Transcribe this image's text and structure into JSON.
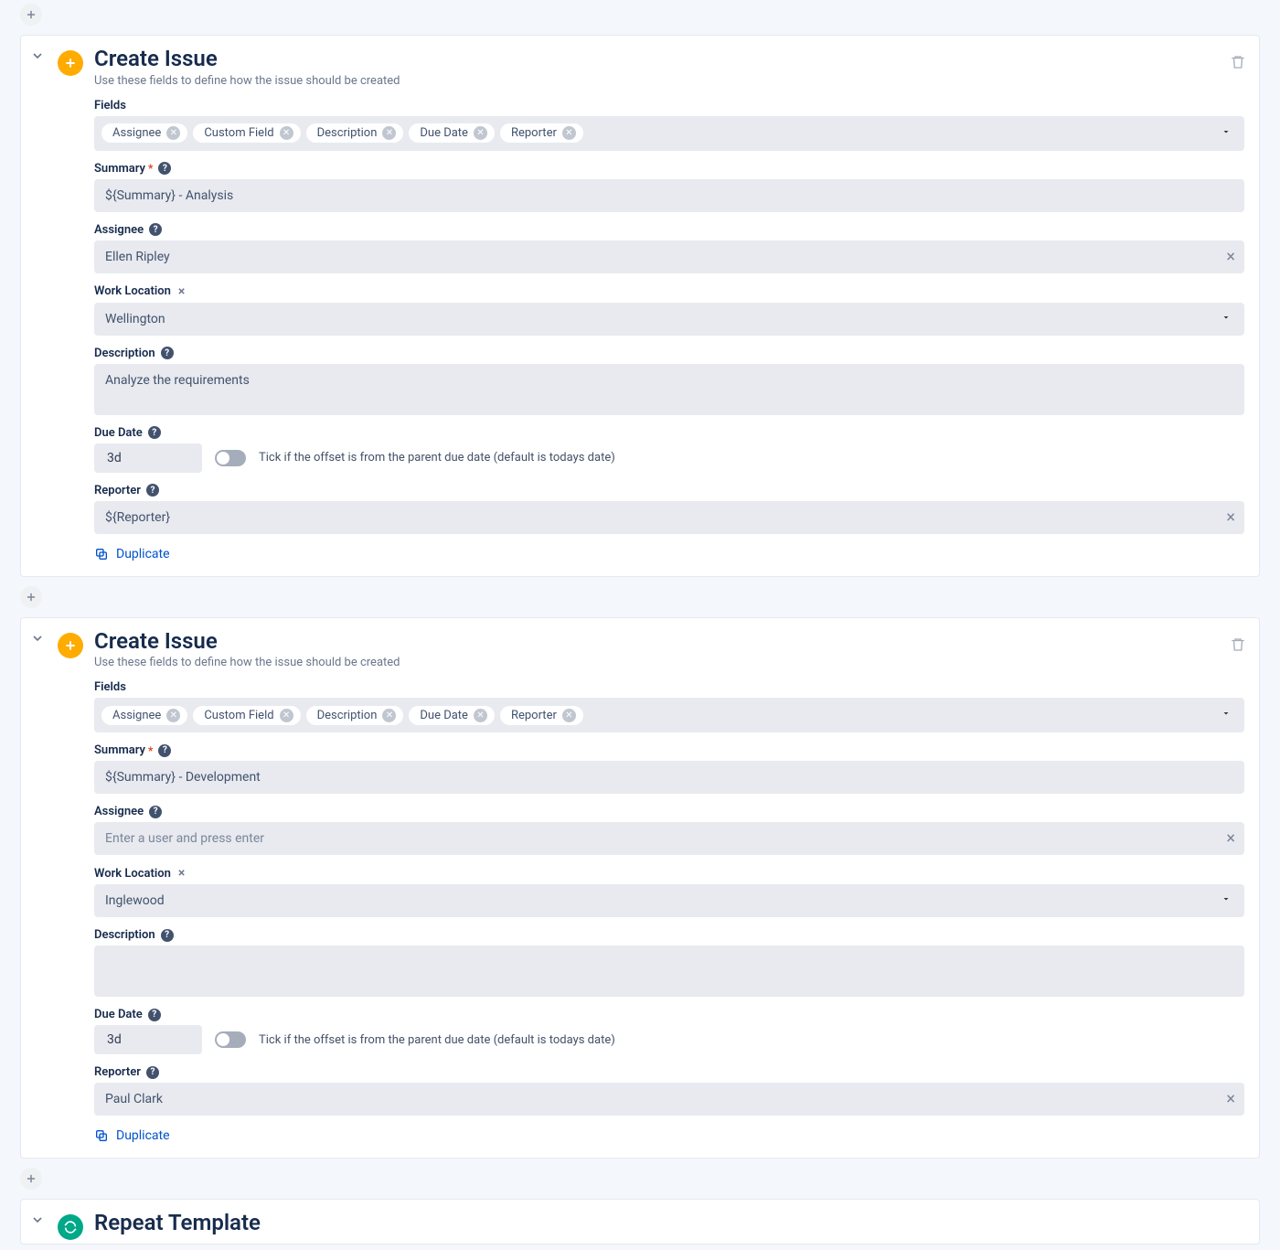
{
  "labels": {
    "fields": "Fields",
    "summary": "Summary",
    "assignee": "Assignee",
    "work_location": "Work Location",
    "description": "Description",
    "due_date": "Due Date",
    "reporter": "Reporter",
    "duplicate": "Duplicate",
    "offset_hint": "Tick if the offset is from the parent due date (default is todays date)"
  },
  "field_chips": [
    "Assignee",
    "Custom Field",
    "Description",
    "Due Date",
    "Reporter"
  ],
  "cards": [
    {
      "title": "Create Issue",
      "subtitle": "Use these fields to define how the issue should be created",
      "summary": "${Summary} - Analysis",
      "assignee": "Ellen Ripley",
      "assignee_placeholder": "",
      "work_location": "Wellington",
      "description": "Analyze the requirements",
      "due_date": "3d",
      "reporter": "${Reporter}"
    },
    {
      "title": "Create Issue",
      "subtitle": "Use these fields to define how the issue should be created",
      "summary": "${Summary} - Development",
      "assignee": "",
      "assignee_placeholder": "Enter a user and press enter",
      "work_location": "Inglewood",
      "description": "",
      "due_date": "3d",
      "reporter": "Paul Clark"
    }
  ],
  "repeat": {
    "title": "Repeat Template"
  }
}
